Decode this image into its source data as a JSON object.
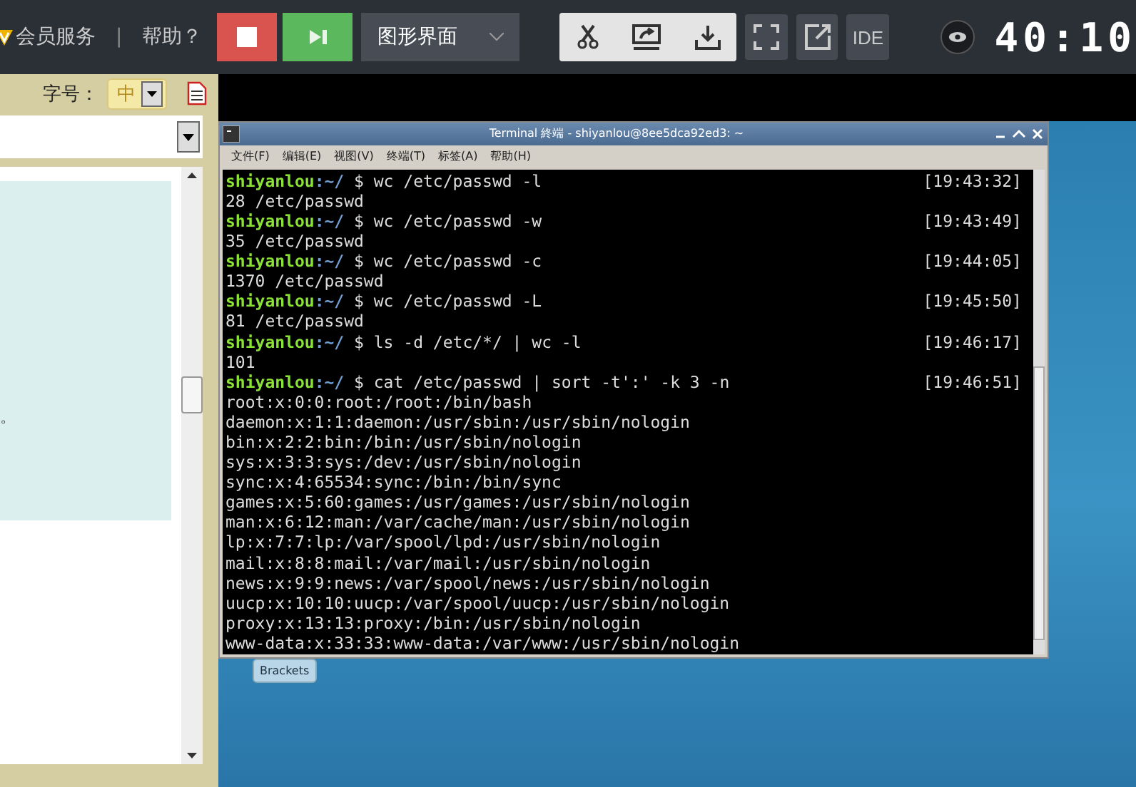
{
  "topbar": {
    "member_link": "会员服务",
    "separator": "|",
    "help_link": "帮助？",
    "mode_dropdown": "图形界面",
    "ide_button": "IDE",
    "timer": "40:10"
  },
  "left_panel": {
    "font_size_label": "字号：",
    "font_size_value": "中",
    "content_fragment": "。"
  },
  "terminal": {
    "title": "Terminal 終端 - shiyanlou@8ee5dca92ed3: ~",
    "menu": [
      "文件(F)",
      "编辑(E)",
      "视图(V)",
      "终端(T)",
      "标签(A)",
      "帮助(H)"
    ],
    "lines": [
      {
        "kind": "prompt",
        "user": "shiyanlou",
        "path": ":~/",
        "command": "$ wc /etc/passwd -l",
        "time": "[19:43:32]"
      },
      {
        "kind": "output",
        "text": "28 /etc/passwd"
      },
      {
        "kind": "prompt",
        "user": "shiyanlou",
        "path": ":~/",
        "command": "$ wc /etc/passwd -w",
        "time": "[19:43:49]"
      },
      {
        "kind": "output",
        "text": "35 /etc/passwd"
      },
      {
        "kind": "prompt",
        "user": "shiyanlou",
        "path": ":~/",
        "command": "$ wc /etc/passwd -c",
        "time": "[19:44:05]"
      },
      {
        "kind": "output",
        "text": "1370 /etc/passwd"
      },
      {
        "kind": "prompt",
        "user": "shiyanlou",
        "path": ":~/",
        "command": "$ wc /etc/passwd -L",
        "time": "[19:45:50]"
      },
      {
        "kind": "output",
        "text": "81 /etc/passwd"
      },
      {
        "kind": "prompt",
        "user": "shiyanlou",
        "path": ":~/",
        "command": "$ ls -d /etc/*/ | wc -l",
        "time": "[19:46:17]"
      },
      {
        "kind": "output",
        "text": "101"
      },
      {
        "kind": "prompt",
        "user": "shiyanlou",
        "path": ":~/",
        "command": "$ cat /etc/passwd | sort -t':' -k 3 -n",
        "time": "[19:46:51]"
      },
      {
        "kind": "output",
        "text": "root:x:0:0:root:/root:/bin/bash"
      },
      {
        "kind": "output",
        "text": "daemon:x:1:1:daemon:/usr/sbin:/usr/sbin/nologin"
      },
      {
        "kind": "output",
        "text": "bin:x:2:2:bin:/bin:/usr/sbin/nologin"
      },
      {
        "kind": "output",
        "text": "sys:x:3:3:sys:/dev:/usr/sbin/nologin"
      },
      {
        "kind": "output",
        "text": "sync:x:4:65534:sync:/bin:/bin/sync"
      },
      {
        "kind": "output",
        "text": "games:x:5:60:games:/usr/games:/usr/sbin/nologin"
      },
      {
        "kind": "output",
        "text": "man:x:6:12:man:/var/cache/man:/usr/sbin/nologin"
      },
      {
        "kind": "output",
        "text": "lp:x:7:7:lp:/var/spool/lpd:/usr/sbin/nologin"
      },
      {
        "kind": "output",
        "text": "mail:x:8:8:mail:/var/mail:/usr/sbin/nologin"
      },
      {
        "kind": "output",
        "text": "news:x:9:9:news:/var/spool/news:/usr/sbin/nologin"
      },
      {
        "kind": "output",
        "text": "uucp:x:10:10:uucp:/var/spool/uucp:/usr/sbin/nologin"
      },
      {
        "kind": "output",
        "text": "proxy:x:13:13:proxy:/bin:/usr/sbin/nologin"
      },
      {
        "kind": "output",
        "text": "www-data:x:33:33:www-data:/var/www:/usr/sbin/nologin"
      }
    ]
  },
  "desktop": {
    "dock_item": "Brackets"
  }
}
